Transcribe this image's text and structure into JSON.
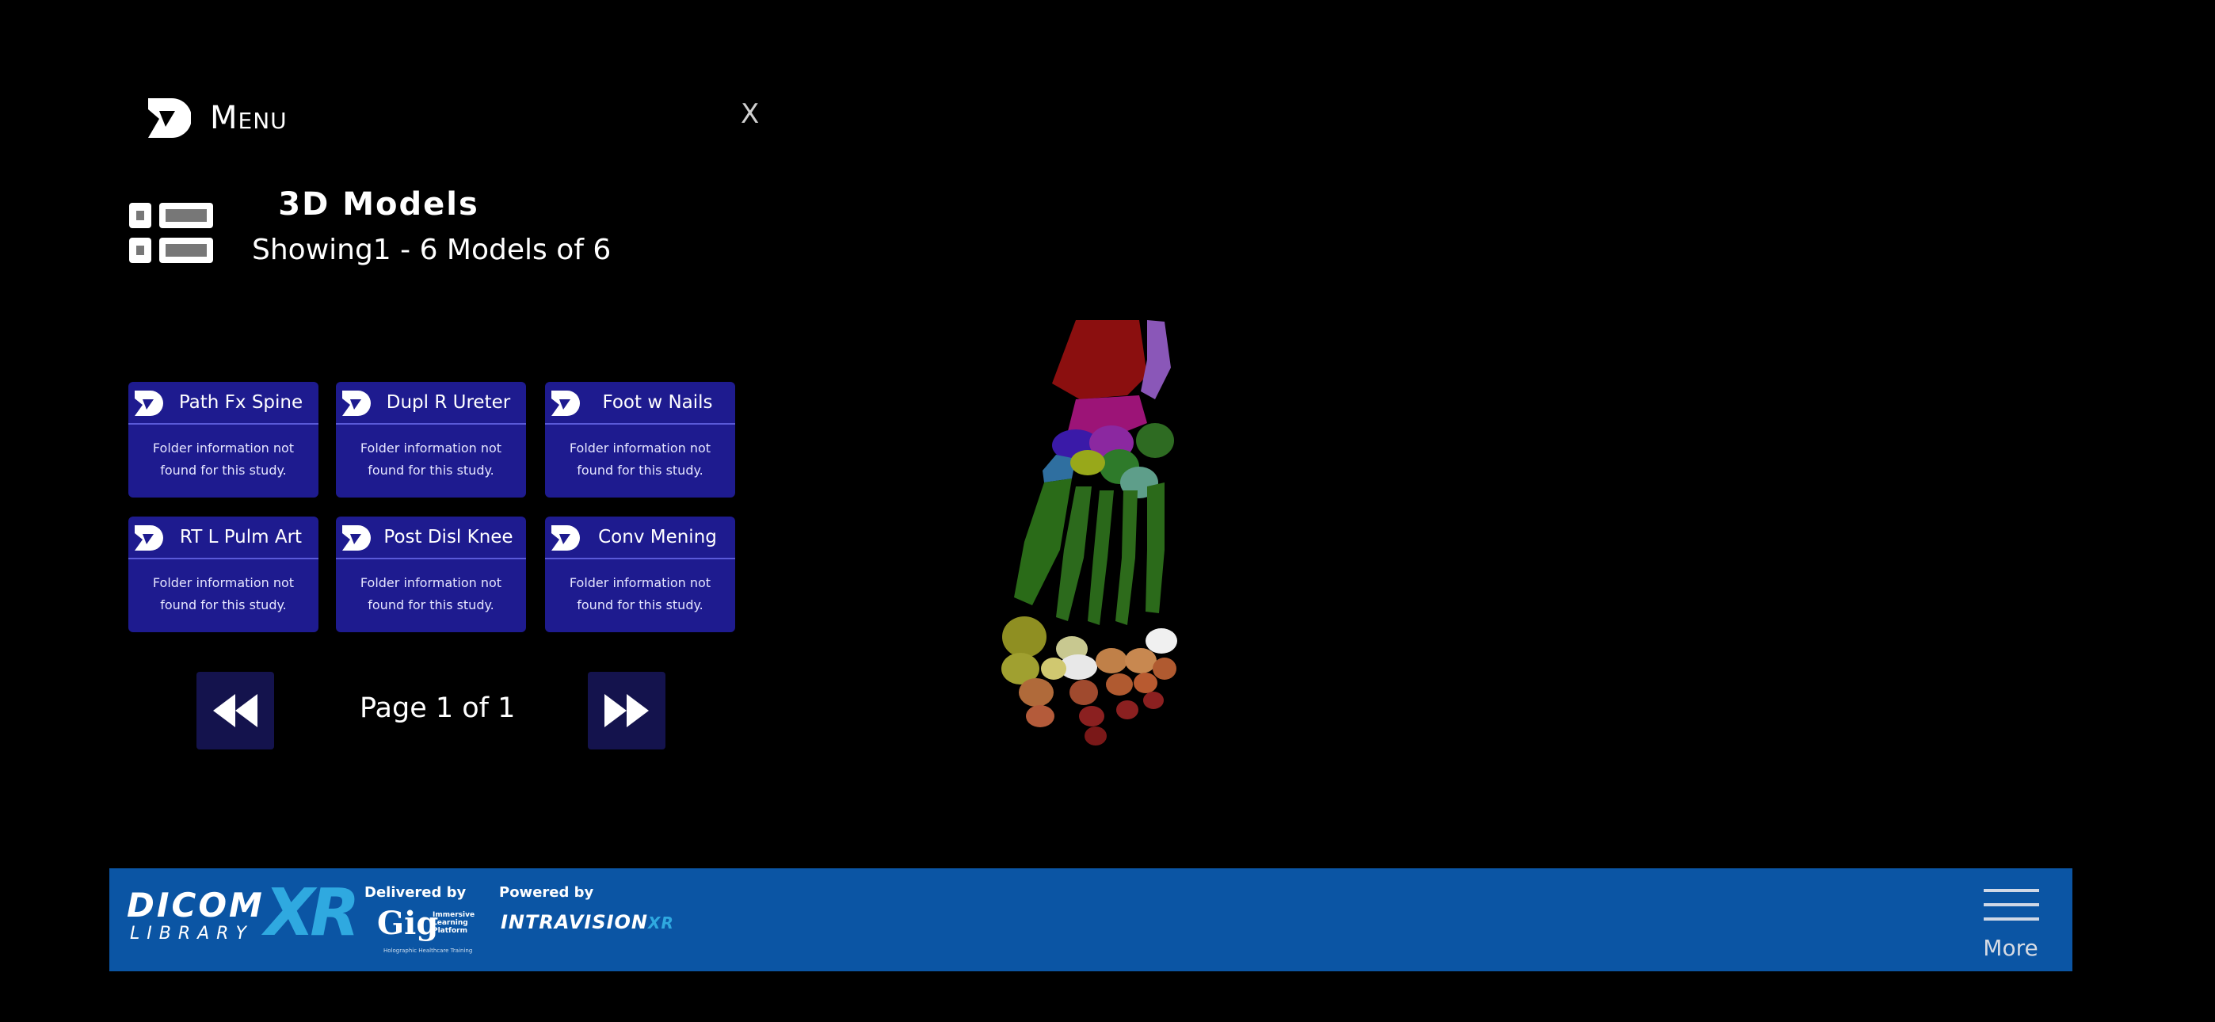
{
  "menu": {
    "title": "Menu",
    "close_label": "X"
  },
  "section": {
    "title": "3D Models",
    "subtitle": "Showing1 - 6 Models of 6"
  },
  "models": [
    {
      "name": "Path Fx Spine",
      "info": "Folder information not found for this study."
    },
    {
      "name": "Dupl R Ureter",
      "info": "Folder information not found for this study."
    },
    {
      "name": "Foot w Nails",
      "info": "Folder information not found for this study."
    },
    {
      "name": "RT L Pulm Art",
      "info": "Folder information not found for this study."
    },
    {
      "name": "Post Disl Knee",
      "info": "Folder information not found for this study."
    },
    {
      "name": "Conv Mening",
      "info": "Folder information not found for this study."
    }
  ],
  "pagination": {
    "label": "Page 1 of 1",
    "prev_icon": "rewind-icon",
    "next_icon": "fast-forward-icon"
  },
  "footer": {
    "brand_dicom": "DICOM",
    "brand_library": "LIBRARY",
    "brand_xr": "XR",
    "delivered_by": "Delivered by",
    "gig_logo": "Gig",
    "gig_sub": "Immersive Learning Platform",
    "gig_tagline": "Holographic Healthcare Training",
    "powered_by": "Powered by",
    "intravision": "INTRAVISION",
    "intravision_xr": "XR",
    "more_label": "More"
  },
  "colors": {
    "card_bg": "#1e1b8f",
    "footer_bg": "#0b55a4",
    "accent": "#2fa9e0",
    "pager_bg": "#14134d"
  }
}
